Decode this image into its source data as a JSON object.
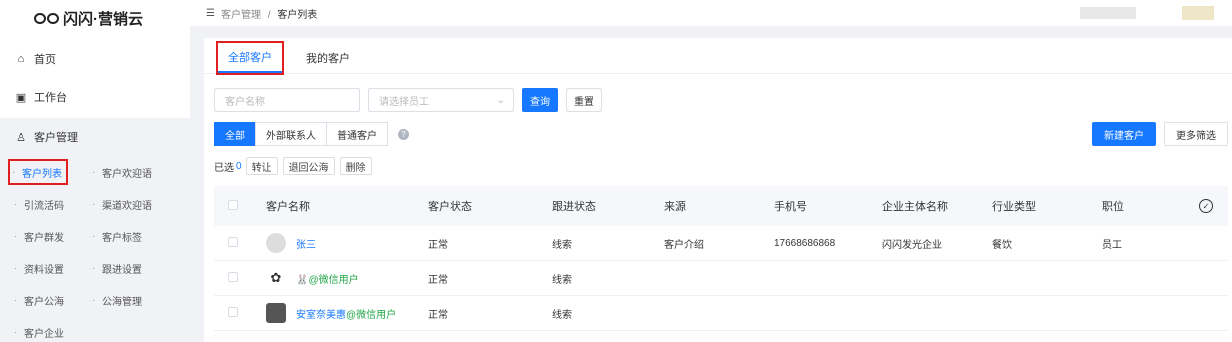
{
  "app": {
    "logo_text": "闪闪·营销云"
  },
  "sidebar": {
    "home": "首页",
    "workbench": "工作台",
    "customer_mgmt": "客户管理",
    "sub_items": [
      {
        "label": "客户列表",
        "active": true
      },
      {
        "label": "客户欢迎语",
        "active": false
      },
      {
        "label": "引流活码",
        "active": false
      },
      {
        "label": "渠道欢迎语",
        "active": false
      },
      {
        "label": "客户群发",
        "active": false
      },
      {
        "label": "客户标签",
        "active": false
      },
      {
        "label": "资料设置",
        "active": false
      },
      {
        "label": "跟进设置",
        "active": false
      },
      {
        "label": "客户公海",
        "active": false
      },
      {
        "label": "公海管理",
        "active": false
      },
      {
        "label": "客户企业",
        "active": false
      }
    ]
  },
  "breadcrumb": {
    "parent": "客户管理",
    "separator": "/",
    "current": "客户列表"
  },
  "tabs": [
    {
      "label": "全部客户",
      "active": true
    },
    {
      "label": "我的客户",
      "active": false
    }
  ],
  "filters": {
    "name_placeholder": "客户名称",
    "staff_placeholder": "请选择员工",
    "search_label": "查询",
    "reset_label": "重置"
  },
  "segments": [
    {
      "label": "全部",
      "active": true
    },
    {
      "label": "外部联系人",
      "active": false
    },
    {
      "label": "普通客户",
      "active": false
    }
  ],
  "selection": {
    "selected_label": "已选",
    "selected_count": "0",
    "actions": [
      "转让",
      "退回公海",
      "删除"
    ]
  },
  "right_buttons": {
    "new_customer": "新建客户",
    "more_filters": "更多筛选"
  },
  "table": {
    "columns": [
      "客户名称",
      "客户状态",
      "跟进状态",
      "来源",
      "手机号",
      "企业主体名称",
      "行业类型",
      "职位"
    ],
    "rows": [
      {
        "name": "张三",
        "status": "正常",
        "follow": "线索",
        "source": "客户介绍",
        "phone": "17668686868",
        "company": "闪闪发光企业",
        "industry": "餐饮",
        "position": "员工"
      },
      {
        "name": "🐰@微信用户",
        "status": "正常",
        "follow": "线索",
        "source": "",
        "phone": "",
        "company": "",
        "industry": "",
        "position": ""
      },
      {
        "name_a": "安室奈美惠",
        "name_b": "@微信用户",
        "status": "正常",
        "follow": "线索",
        "source": "",
        "phone": "",
        "company": "",
        "industry": "",
        "position": ""
      }
    ]
  },
  "colors": {
    "accent": "#1677ff",
    "wechat_green": "#22a447",
    "highlight_red": "#e02020"
  }
}
